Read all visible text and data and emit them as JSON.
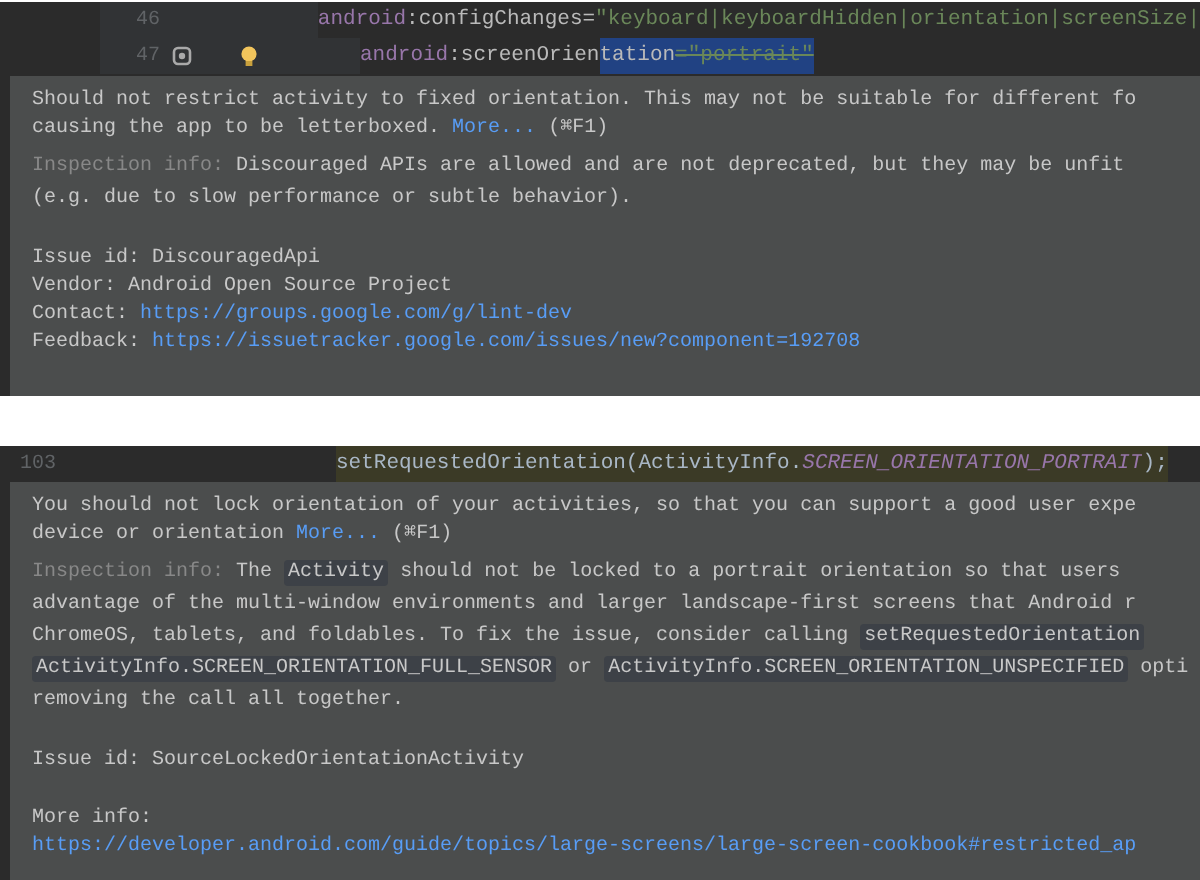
{
  "panels": [
    {
      "code_lines": [
        {
          "number": "46",
          "activity_marker": false,
          "intention_bulb": false,
          "segments": [
            {
              "kind": "namespace",
              "text": "android",
              "selected": false
            },
            {
              "kind": "attribute",
              "text": ":configChanges=",
              "selected": false
            },
            {
              "kind": "string",
              "text": "\"keyboard|keyboardHidden|orientation|screenSize|",
              "selected": false
            }
          ]
        },
        {
          "number": "47",
          "activity_marker": true,
          "intention_bulb": true,
          "segments": [
            {
              "kind": "namespace",
              "text": "android",
              "selected": false
            },
            {
              "kind": "attribute",
              "text": ":screenOrien",
              "selected": false
            },
            {
              "kind": "attribute",
              "text": "tation",
              "selected": true
            },
            {
              "kind": "deprecated",
              "text": "=\"portrait\"",
              "selected": true
            }
          ]
        }
      ],
      "tooltip": {
        "paragraphs": [
          {
            "kind": "message",
            "lines": [
              [
                {
                  "kind": "text",
                  "text": "Should not restrict activity to fixed orientation. This may not be suitable for different fo"
                }
              ],
              [
                {
                  "kind": "text",
                  "text": "causing the app to be letterboxed. "
                },
                {
                  "kind": "link",
                  "text": "More..."
                },
                {
                  "kind": "text",
                  "text": " (⌘F1)"
                }
              ]
            ]
          },
          {
            "kind": "inspection",
            "lines": [
              [
                {
                  "kind": "label",
                  "text": "Inspection info: "
                },
                {
                  "kind": "text",
                  "text": "Discouraged APIs are allowed and are not deprecated, but they may be unfit"
                }
              ],
              [
                {
                  "kind": "text",
                  "text": "(e.g. due to slow performance or subtle behavior)."
                }
              ]
            ]
          },
          {
            "kind": "details",
            "lines": [
              [
                {
                  "kind": "text",
                  "text": "Issue id: DiscouragedApi"
                }
              ],
              [
                {
                  "kind": "text",
                  "text": "Vendor: Android Open Source Project"
                }
              ],
              [
                {
                  "kind": "text",
                  "text": "Contact: "
                },
                {
                  "kind": "link",
                  "text": "https://groups.google.com/g/lint-dev"
                }
              ],
              [
                {
                  "kind": "text",
                  "text": "Feedback: "
                },
                {
                  "kind": "link",
                  "text": "https://issuetracker.google.com/issues/new?component=192708"
                }
              ]
            ]
          }
        ]
      }
    },
    {
      "code_lines": [
        {
          "number": "103",
          "activity_marker": false,
          "intention_bulb": false,
          "segments": [
            {
              "kind": "plain",
              "text": "setRequestedOrientation(ActivityInfo.",
              "selected": true
            },
            {
              "kind": "constant",
              "text": "SCREEN_ORIENTATION_PORTRAIT",
              "selected": true
            },
            {
              "kind": "plain",
              "text": ");",
              "selected": true
            }
          ]
        }
      ],
      "tooltip": {
        "paragraphs": [
          {
            "kind": "message",
            "lines": [
              [
                {
                  "kind": "text",
                  "text": "You should not lock orientation of your activities, so that you can support a good user expe"
                }
              ],
              [
                {
                  "kind": "text",
                  "text": "device or orientation "
                },
                {
                  "kind": "link",
                  "text": "More..."
                },
                {
                  "kind": "text",
                  "text": " (⌘F1)"
                }
              ]
            ]
          },
          {
            "kind": "inspection",
            "lines": [
              [
                {
                  "kind": "label",
                  "text": "Inspection info: "
                },
                {
                  "kind": "text",
                  "text": "The "
                },
                {
                  "kind": "code",
                  "text": "Activity"
                },
                {
                  "kind": "text",
                  "text": " should not be locked to a portrait orientation so that users"
                }
              ],
              [
                {
                  "kind": "text",
                  "text": "advantage of the multi-window environments and larger landscape-first screens that Android r"
                }
              ],
              [
                {
                  "kind": "text",
                  "text": "ChromeOS, tablets, and foldables. To fix the issue, consider calling "
                },
                {
                  "kind": "code",
                  "text": "setRequestedOrientation"
                }
              ],
              [
                {
                  "kind": "code",
                  "text": "ActivityInfo.SCREEN_ORIENTATION_FULL_SENSOR"
                },
                {
                  "kind": "text",
                  "text": " or "
                },
                {
                  "kind": "code",
                  "text": "ActivityInfo.SCREEN_ORIENTATION_UNSPECIFIED"
                },
                {
                  "kind": "text",
                  "text": " opti"
                }
              ],
              [
                {
                  "kind": "text",
                  "text": "removing the call all together."
                }
              ]
            ]
          },
          {
            "kind": "details",
            "lines": [
              [
                {
                  "kind": "text",
                  "text": "Issue id: SourceLockedOrientationActivity"
                }
              ]
            ]
          },
          {
            "kind": "details",
            "lines": [
              [
                {
                  "kind": "text",
                  "text": "More info:"
                }
              ],
              [
                {
                  "kind": "link",
                  "text": "https://developer.android.com/guide/topics/large-screens/large-screen-cookbook#restricted_ap"
                }
              ]
            ]
          }
        ]
      }
    }
  ]
}
